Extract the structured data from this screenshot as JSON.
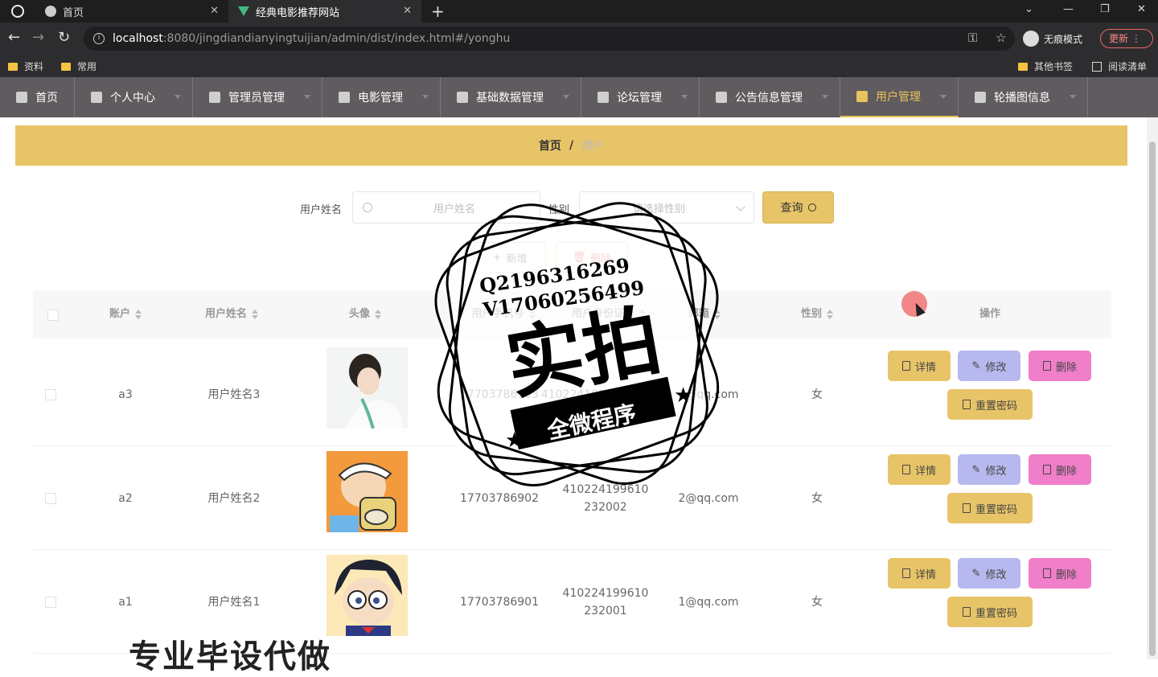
{
  "browser": {
    "tabs": [
      {
        "title": "首页"
      },
      {
        "title": "经典电影推荐网站"
      }
    ],
    "url_host": "localhost",
    "url_path": ":8080/jingdiandianyingtuijian/admin/dist/index.html#/yonghu",
    "incognito_label": "无痕模式",
    "update_label": "更新",
    "bookmarks": [
      "资料",
      "常用"
    ],
    "bookmarks_right": [
      "其他书签",
      "阅读清单"
    ]
  },
  "nav": {
    "items": [
      {
        "label": "首页",
        "icon": "home-icon"
      },
      {
        "label": "个人中心",
        "icon": "user-icon"
      },
      {
        "label": "管理员管理",
        "icon": "admin-icon"
      },
      {
        "label": "电影管理",
        "icon": "film-icon"
      },
      {
        "label": "基础数据管理",
        "icon": "database-icon"
      },
      {
        "label": "论坛管理",
        "icon": "forum-icon"
      },
      {
        "label": "公告信息管理",
        "icon": "notice-icon"
      },
      {
        "label": "用户管理",
        "icon": "chart-icon",
        "active": true
      },
      {
        "label": "轮播图信息",
        "icon": "send-icon"
      }
    ]
  },
  "breadcrumb": {
    "home": "首页",
    "separator": "/",
    "current": "用户"
  },
  "search": {
    "name_label": "用户姓名",
    "name_placeholder": "用户姓名",
    "gender_label": "性别",
    "gender_placeholder": "请选择性别",
    "query_label": "查询"
  },
  "actions": {
    "add_label": "新增",
    "delete_label": "删除"
  },
  "table": {
    "headers": [
      "账户",
      "用户姓名",
      "头像",
      "用户手机号",
      "用户身份证号",
      "邮箱",
      "性别",
      "操作"
    ],
    "rows": [
      {
        "account": "a3",
        "name": "用户姓名3",
        "phone": "17703786903",
        "id_card": "410224199610232003",
        "email": "3@qq.com",
        "gender": "女"
      },
      {
        "account": "a2",
        "name": "用户姓名2",
        "phone": "17703786902",
        "id_card": "410224199610232002",
        "email": "2@qq.com",
        "gender": "女"
      },
      {
        "account": "a1",
        "name": "用户姓名1",
        "phone": "17703786901",
        "id_card": "410224199610232001",
        "email": "1@qq.com",
        "gender": "女"
      }
    ],
    "op_labels": {
      "detail": "详情",
      "edit": "修改",
      "delete": "删除",
      "reset": "重置密码"
    }
  },
  "watermark": {
    "line1": "Q2196316269",
    "line2": "V17060256499",
    "big": "实拍",
    "banner": "全微程序",
    "bottom": "专业毕设代做"
  },
  "colors": {
    "accent": "#e8c468",
    "nav_bg": "#5f5b5f",
    "edit": "#b6b8ee",
    "delete": "#f07ec9"
  }
}
